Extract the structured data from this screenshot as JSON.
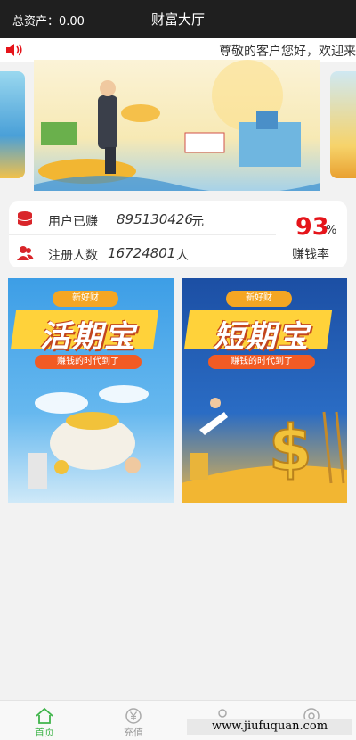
{
  "header": {
    "total_assets": "总资产：0.00",
    "title": "财富大厅"
  },
  "notice": {
    "text": "尊敬的客户您好，欢迎来",
    "icon": "speaker-icon"
  },
  "stats": {
    "earned_label": "用户已赚",
    "earned_value": "895130426",
    "earned_unit": "元",
    "registered_label": "注册人数",
    "registered_value": "16724801",
    "registered_unit": "人",
    "rate_value": "93",
    "rate_percent": "%",
    "rate_label": "赚钱率",
    "accent_color": "#e5141a"
  },
  "products": [
    {
      "badge": "新好财",
      "title": "活期宝",
      "subtitle": "赚钱的时代到了"
    },
    {
      "badge": "新好财",
      "title": "短期宝",
      "subtitle": "赚钱的时代到了"
    }
  ],
  "tabs": [
    {
      "label": "首页",
      "icon": "home-icon",
      "active": true
    },
    {
      "label": "充值",
      "icon": "yen-icon",
      "active": false
    },
    {
      "label": "",
      "icon": "user-icon",
      "active": false
    },
    {
      "label": "",
      "icon": "settings-icon",
      "active": false
    }
  ],
  "watermark": "www.jiufuquan.com"
}
